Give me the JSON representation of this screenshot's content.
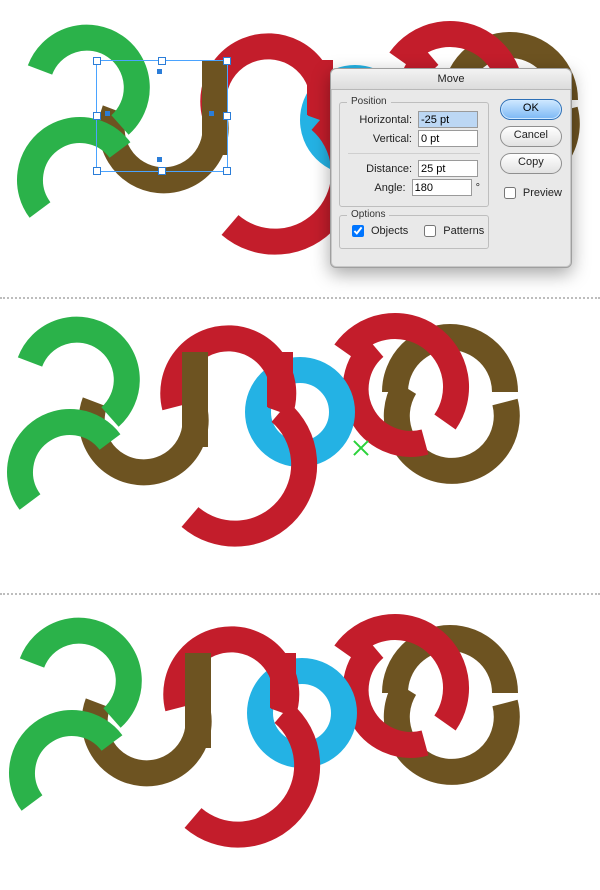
{
  "dialog": {
    "title": "Move",
    "position_legend": "Position",
    "horizontal_label": "Horizontal:",
    "horizontal_value": "-25 pt",
    "vertical_label": "Vertical:",
    "vertical_value": "0 pt",
    "distance_label": "Distance:",
    "distance_value": "25 pt",
    "angle_label": "Angle:",
    "angle_value": "180",
    "angle_unit": "°",
    "options_legend": "Options",
    "objects_label": "Objects",
    "patterns_label": "Patterns",
    "ok": "OK",
    "cancel": "Cancel",
    "copy": "Copy",
    "preview_label": "Preview"
  },
  "colors": {
    "green": "#2bb24a",
    "red": "#c31d2b",
    "blue": "#24b2e4",
    "brown": "#6d5321"
  },
  "chart_data": null
}
